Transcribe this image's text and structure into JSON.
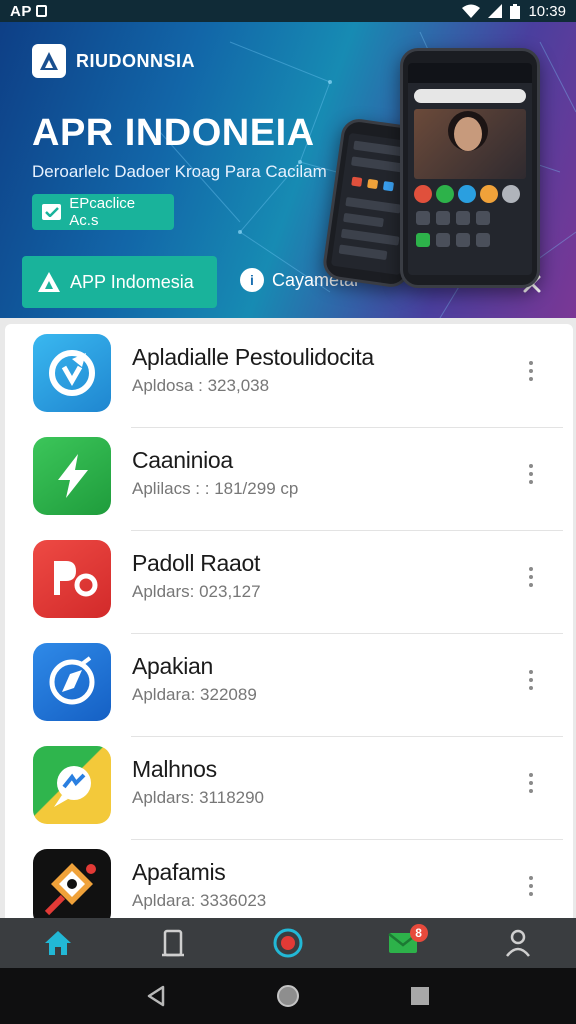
{
  "status_bar": {
    "left_text": "AP",
    "time": "10:39"
  },
  "hero": {
    "brand_name": "RIUDONNSIA",
    "title": "APR INDONEIA",
    "subtitle": "Deroarlelc Dadoer Kroag Para Cacilam",
    "chip_label": "EPcaclice Ac.s",
    "primary_button": "APP Indomesia",
    "secondary_button": "Cayametar",
    "secondary_icon_glyph": "i"
  },
  "apps": [
    {
      "name": "Apladialle Pestoulidocita",
      "meta": "Apldosa : 323,038",
      "icon": "sync-arrows-icon",
      "color": "#2a9fe0"
    },
    {
      "name": "Caaninioa",
      "meta": "Aplilacs : : 181/299  cp",
      "icon": "lightning-icon",
      "color": "#2db24a"
    },
    {
      "name": "Padoll Raaot",
      "meta": "Apldars: 023,127",
      "icon": "po-letters-icon",
      "color": "#e23a36"
    },
    {
      "name": "Apakian",
      "meta": "Apldara: 322089",
      "icon": "compass-icon",
      "color": "#1f74d6"
    },
    {
      "name": "Malhnos",
      "meta": "Apldars: 3118290",
      "icon": "messenger-icon",
      "color": "#2aa84a"
    },
    {
      "name": "Apafamis",
      "meta": "Apldara: 3336023",
      "icon": "game-badge-icon",
      "color": "#111111"
    }
  ],
  "tab_bar": {
    "tabs": [
      "home-icon",
      "document-icon",
      "record-icon",
      "mail-icon",
      "profile-icon"
    ],
    "mail_badge": "8",
    "active_color": "#22b8d6"
  },
  "colors": {
    "accent": "#19b39b",
    "status_bar": "#102b37",
    "tab_bar": "#3a3d40"
  }
}
